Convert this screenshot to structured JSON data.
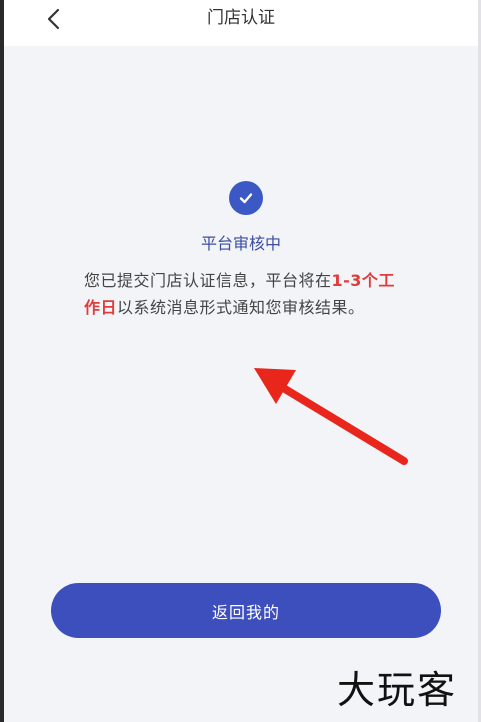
{
  "header": {
    "back_icon": "chevron-left-icon",
    "title": "门店认证"
  },
  "status": {
    "icon": "check-circle-icon",
    "title": "平台审核中",
    "message_part1": "您已提交门店认证信息，平台将在",
    "message_highlight": "1-3个工作日",
    "message_part2": "以系统消息形式通知您审核结果。"
  },
  "annotation": {
    "icon": "red-arrow-icon",
    "color": "#e8261c"
  },
  "actions": {
    "return_label": "返回我的"
  },
  "watermark": {
    "text": "大玩客"
  },
  "colors": {
    "accent": "#3d4fbd",
    "highlight": "#e03c3c",
    "background": "#f3f4f8"
  }
}
